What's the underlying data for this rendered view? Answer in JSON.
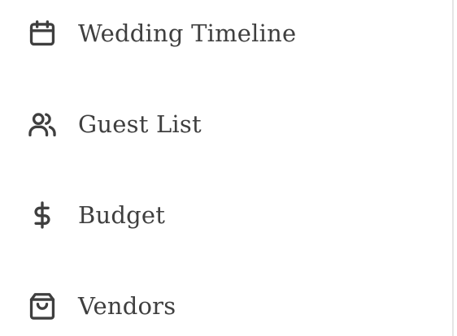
{
  "sidebar": {
    "items": [
      {
        "label": "Wedding Timeline",
        "icon": "calendar-icon"
      },
      {
        "label": "Guest List",
        "icon": "users-icon"
      },
      {
        "label": "Budget",
        "icon": "dollar-icon"
      },
      {
        "label": "Vendors",
        "icon": "shopping-bag-icon"
      }
    ]
  },
  "colors": {
    "text": "#3f3f3f",
    "icon": "#3f3f3f",
    "background": "#ffffff",
    "divider": "#e5e5e5"
  }
}
